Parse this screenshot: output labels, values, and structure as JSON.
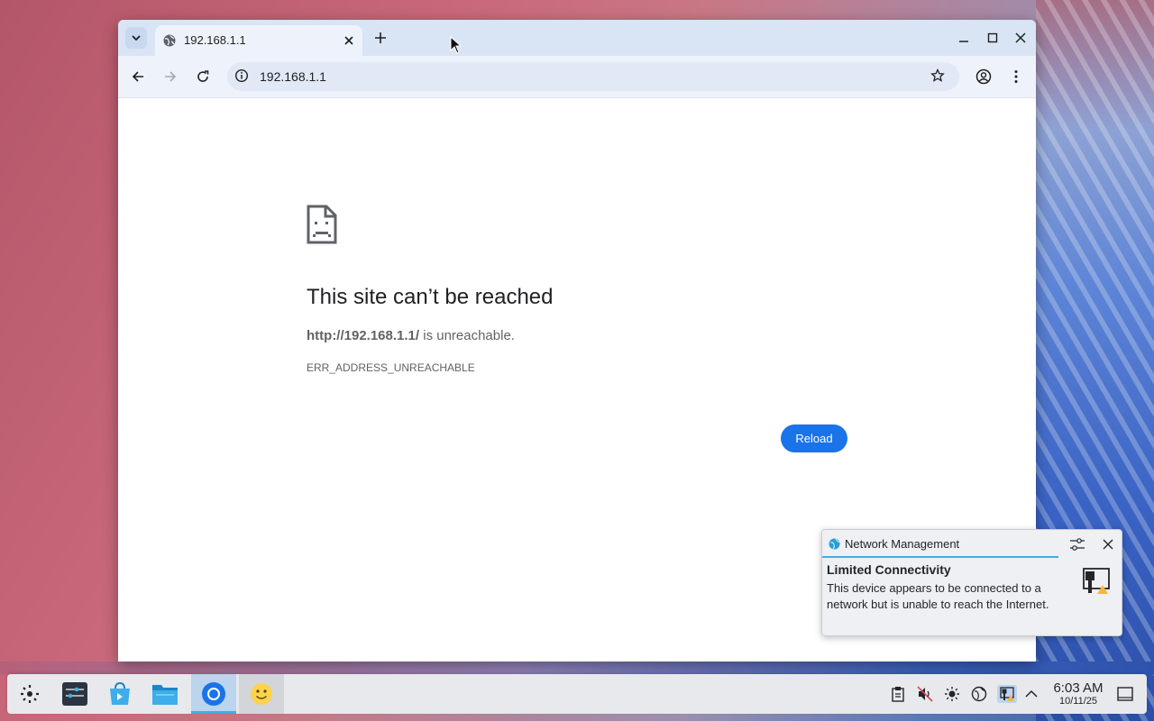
{
  "browser": {
    "tab": {
      "title": "192.168.1.1"
    },
    "address_bar": {
      "url": "192.168.1.1"
    }
  },
  "error_page": {
    "title": "This site can’t be reached",
    "host": "http://192.168.1.1/",
    "message_suffix": " is unreachable.",
    "error_code": "ERR_ADDRESS_UNREACHABLE",
    "reload_label": "Reload"
  },
  "notification": {
    "app": "Network Management",
    "summary": "Limited Connectivity",
    "body": "This device appears to be connected to a network but is unable to reach the Internet."
  },
  "taskbar": {
    "apps": [
      "application-launcher-icon",
      "system-settings-icon",
      "discover-store-icon",
      "file-manager-icon",
      "chromium-icon",
      "smiley-app-icon"
    ],
    "clock": {
      "time": "6:03 AM",
      "date": "10/11/25"
    }
  },
  "colors": {
    "accent": "#1a73e8",
    "tabstrip": "#d9e4f5",
    "notification_accent": "#3daee9"
  }
}
